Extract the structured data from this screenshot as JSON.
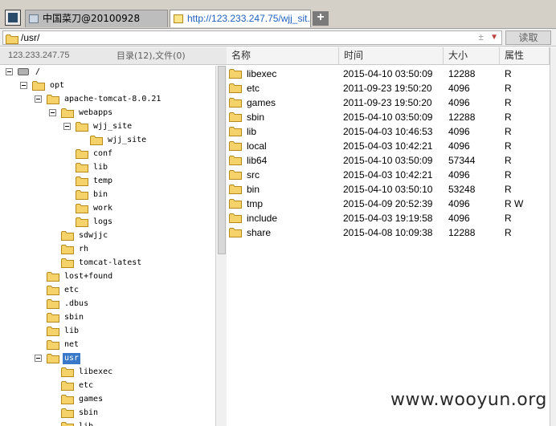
{
  "tabs": [
    {
      "label": "中国菜刀@20100928",
      "active": false
    },
    {
      "label": "http://123.233.247.75/wjj_sit...",
      "active": true
    }
  ],
  "new_tab_label": "+",
  "address": {
    "value": "/usr/",
    "pm": "±",
    "read_button": "读取"
  },
  "left_header": {
    "ip": "123.233.247.75",
    "count": "目录(12),文件(0)"
  },
  "tree": [
    {
      "label": "/",
      "icon": "drive-icon",
      "toggle": true
    },
    {
      "label": "opt",
      "icon": "folder-icon",
      "toggle": true
    },
    {
      "label": "apache-tomcat-8.0.21",
      "icon": "folder-icon",
      "toggle": true
    },
    {
      "label": "webapps",
      "icon": "folder-icon",
      "toggle": true
    },
    {
      "label": "wjj_site",
      "icon": "folder-icon",
      "toggle": true
    },
    {
      "label": "wjj_site",
      "icon": "folder-icon",
      "toggle": false
    },
    {
      "label": "conf",
      "icon": "folder-icon",
      "toggle": false
    },
    {
      "label": "lib",
      "icon": "folder-icon",
      "toggle": false
    },
    {
      "label": "temp",
      "icon": "folder-icon",
      "toggle": false
    },
    {
      "label": "bin",
      "icon": "folder-icon",
      "toggle": false
    },
    {
      "label": "work",
      "icon": "folder-icon",
      "toggle": false
    },
    {
      "label": "logs",
      "icon": "folder-icon",
      "toggle": false
    },
    {
      "label": "sdwjjc",
      "icon": "folder-icon",
      "toggle": false
    },
    {
      "label": "rh",
      "icon": "folder-icon",
      "toggle": false
    },
    {
      "label": "tomcat-latest",
      "icon": "folder-icon",
      "toggle": false
    },
    {
      "label": "lost+found",
      "icon": "folder-icon",
      "toggle": false
    },
    {
      "label": "etc",
      "icon": "folder-icon",
      "toggle": false
    },
    {
      "label": ".dbus",
      "icon": "folder-icon",
      "toggle": false
    },
    {
      "label": "sbin",
      "icon": "folder-icon",
      "toggle": false
    },
    {
      "label": "lib",
      "icon": "folder-icon",
      "toggle": false
    },
    {
      "label": "net",
      "icon": "folder-icon",
      "toggle": false
    },
    {
      "label": "usr",
      "icon": "folder-icon",
      "toggle": true,
      "selected": true
    },
    {
      "label": "libexec",
      "icon": "folder-icon",
      "toggle": false
    },
    {
      "label": "etc",
      "icon": "folder-icon",
      "toggle": false
    },
    {
      "label": "games",
      "icon": "folder-icon",
      "toggle": false
    },
    {
      "label": "sbin",
      "icon": "folder-icon",
      "toggle": false
    },
    {
      "label": "lib",
      "icon": "folder-icon",
      "toggle": false
    }
  ],
  "columns": {
    "name": "名称",
    "time": "时间",
    "size": "大小",
    "attr": "属性"
  },
  "files": [
    {
      "name": "libexec",
      "time": "2015-04-10 03:50:09",
      "size": "12288",
      "attr": "R"
    },
    {
      "name": "etc",
      "time": "2011-09-23 19:50:20",
      "size": "4096",
      "attr": "R"
    },
    {
      "name": "games",
      "time": "2011-09-23 19:50:20",
      "size": "4096",
      "attr": "R"
    },
    {
      "name": "sbin",
      "time": "2015-04-10 03:50:09",
      "size": "12288",
      "attr": "R"
    },
    {
      "name": "lib",
      "time": "2015-04-03 10:46:53",
      "size": "4096",
      "attr": "R"
    },
    {
      "name": "local",
      "time": "2015-04-03 10:42:21",
      "size": "4096",
      "attr": "R"
    },
    {
      "name": "lib64",
      "time": "2015-04-10 03:50:09",
      "size": "57344",
      "attr": "R"
    },
    {
      "name": "src",
      "time": "2015-04-03 10:42:21",
      "size": "4096",
      "attr": "R"
    },
    {
      "name": "bin",
      "time": "2015-04-10 03:50:10",
      "size": "53248",
      "attr": "R"
    },
    {
      "name": "tmp",
      "time": "2015-04-09 20:52:39",
      "size": "4096",
      "attr": "R W"
    },
    {
      "name": "include",
      "time": "2015-04-03 19:19:58",
      "size": "4096",
      "attr": "R"
    },
    {
      "name": "share",
      "time": "2015-04-08 10:09:38",
      "size": "12288",
      "attr": "R"
    }
  ],
  "watermark": "www.wooyun.org",
  "colors": {
    "folder": "#f5d36a",
    "folder_border": "#b58a1a",
    "selection": "#3a78c8"
  }
}
